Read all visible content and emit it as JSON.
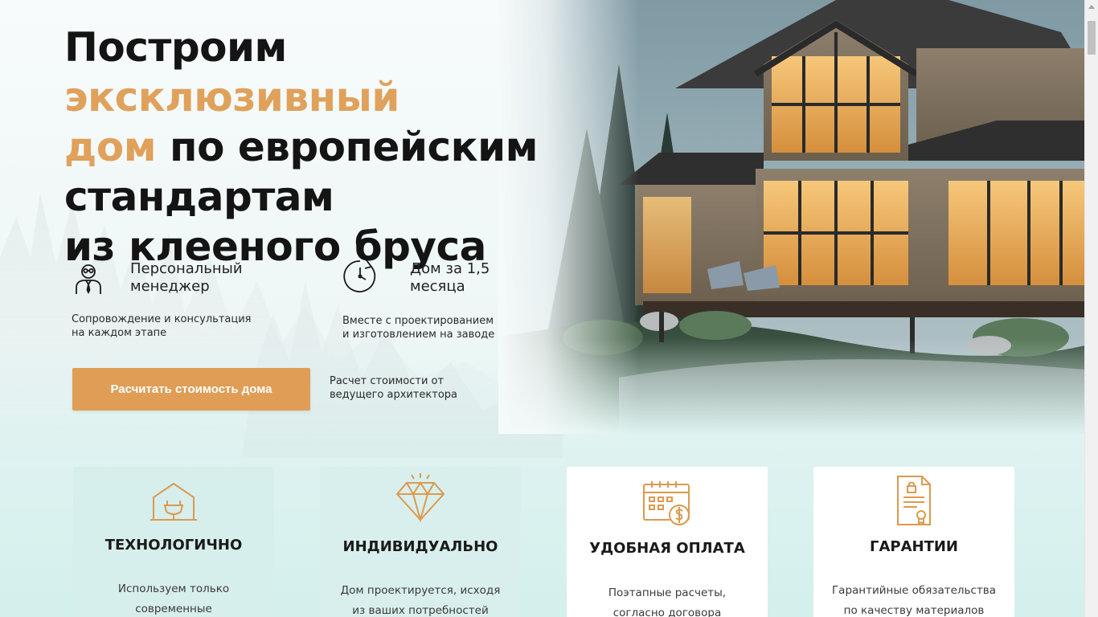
{
  "hero": {
    "title_part1": "Построим ",
    "title_accent1": "эксклюзивный",
    "title_accent2": "дом",
    "title_part2": " по европейским",
    "title_line3": "стандартам",
    "title_line4": "из клееного бруса"
  },
  "features": [
    {
      "label_line1": "Персональный",
      "label_line2": "менеджер",
      "sub_line1": "Сопровождение и консультация",
      "sub_line2": "на каждом этапе",
      "icon": "manager-icon"
    },
    {
      "label_line1": "Дом за 1,5",
      "label_line2": "месяца",
      "sub_line1": "Вместе с проектированием",
      "sub_line2": "и изготовлением на заводе",
      "icon": "clock-icon"
    }
  ],
  "cta": {
    "button_label": "Расчитать стоимость дома",
    "note_line1": "Расчет стоимости от",
    "note_line2": "ведущего архитектора"
  },
  "cards": [
    {
      "title": "ТЕХНОЛОГИЧНО",
      "text_line1": "Используем только",
      "text_line2": "современные",
      "icon": "smart-house-icon"
    },
    {
      "title": "ИНДИВИДУАЛЬНО",
      "text_line1": "Дом проектируется, исходя",
      "text_line2": "из ваших потребностей",
      "icon": "diamond-icon"
    },
    {
      "title": "УДОБНАЯ ОПЛАТА",
      "text_line1": "Поэтапные расчеты,",
      "text_line2": "согласно договора",
      "icon": "calendar-payment-icon"
    },
    {
      "title": "ГАРАНТИИ",
      "text_line1": "Гарантийные обязательства",
      "text_line2": "по качеству материалов",
      "icon": "certificate-icon"
    }
  ],
  "colors": {
    "accent": "#e0a15b",
    "button": "#e09d55",
    "card_teal": "#d6eeec",
    "card_white": "#ffffff"
  }
}
